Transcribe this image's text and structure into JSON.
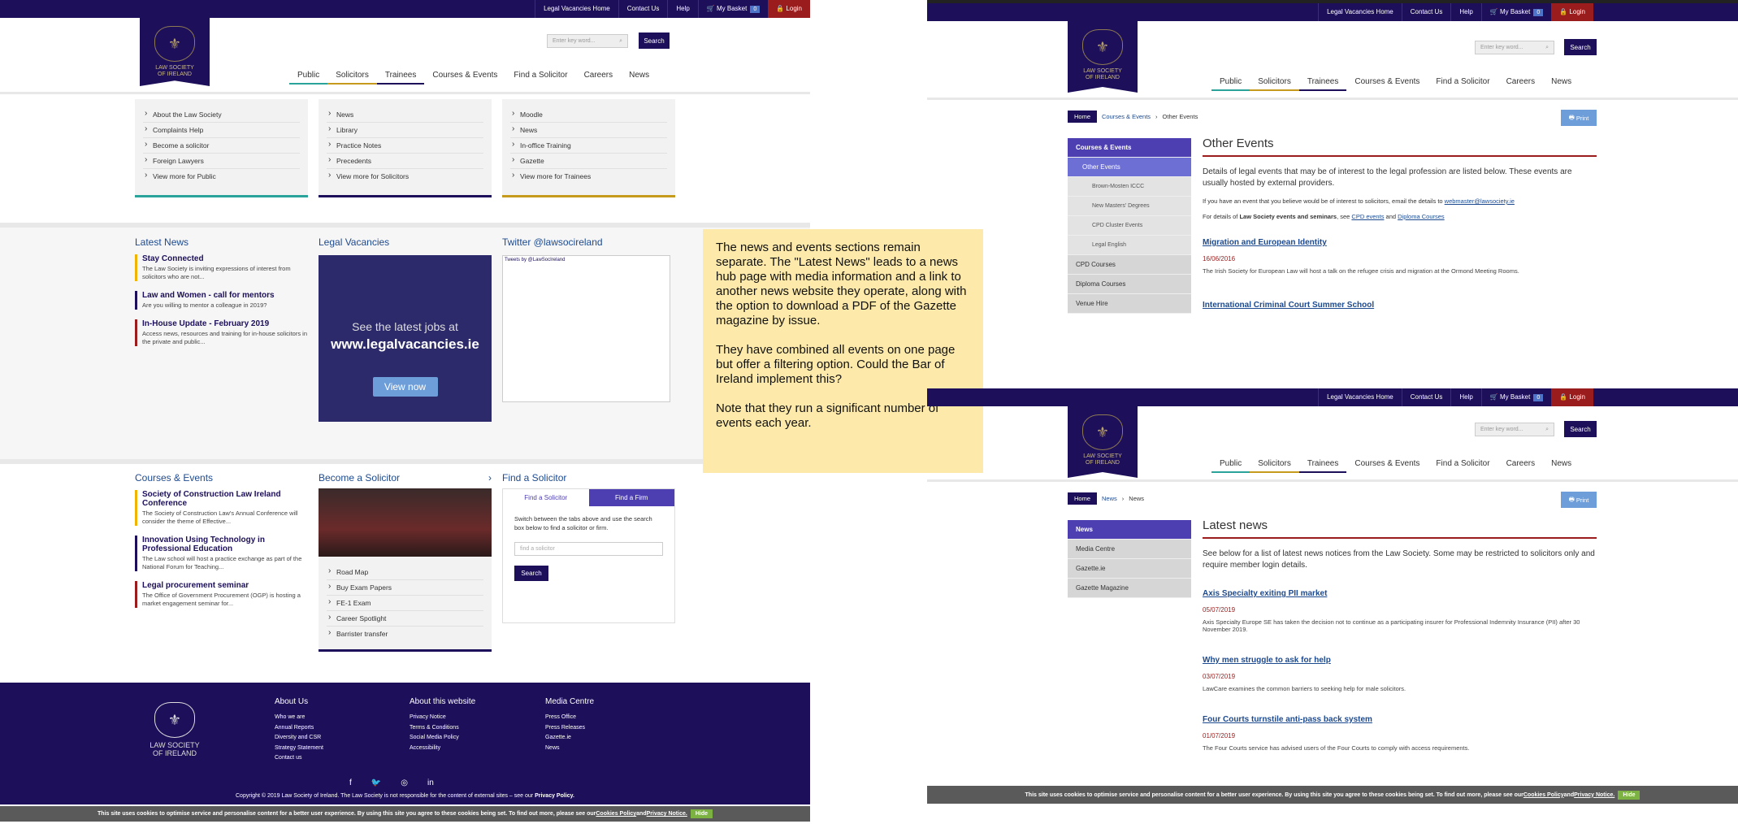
{
  "topnav": {
    "vacancies": "Legal Vacancies Home",
    "contact": "Contact Us",
    "help": "Help",
    "basket": "My Basket",
    "basket_count": "0",
    "login": "Login"
  },
  "logo": {
    "line1": "LAW SOCIETY",
    "line2": "OF IRELAND"
  },
  "search": {
    "placeholder": "Enter key word...",
    "button": "Search"
  },
  "mainnav": [
    "Public",
    "Solicitors",
    "Trainees",
    "Courses & Events",
    "Find a Solicitor",
    "Careers",
    "News"
  ],
  "mega": [
    [
      "About the Law Society",
      "Complaints Help",
      "Become a solicitor",
      "Foreign Lawyers",
      "View more for Public"
    ],
    [
      "News",
      "Library",
      "Practice Notes",
      "Precedents",
      "View more for Solicitors"
    ],
    [
      "Moodle",
      "News",
      "In-office Training",
      "Gazette",
      "View more for Trainees"
    ]
  ],
  "latest": {
    "title": "Latest News",
    "items": [
      {
        "t": "Stay Connected",
        "d": "The Law Society is inviting expressions of interest from solicitors who are not..."
      },
      {
        "t": "Law and Women - call for mentors",
        "d": "Are you willing to mentor a colleague in 2019?"
      },
      {
        "t": "In-House Update - February 2019",
        "d": "Access news, resources and training for in-house solicitors in the private and public..."
      }
    ]
  },
  "vacancies": {
    "title": "Legal Vacancies",
    "line1": "See the latest jobs at",
    "line2": "www.legalvacancies.ie",
    "button": "View now"
  },
  "twitter": {
    "title": "Twitter @lawsocireland",
    "tweets": "Tweets by @LawSocIreland"
  },
  "note": {
    "p1": "The news and events sections remain separate. The \"Latest News\" leads to a news hub page with media information and a link to another news website they operate, along with the option to download a PDF of the Gazette magazine by issue.",
    "p2": "They have combined all events on one page but offer a filtering option. Could the Bar of Ireland implement this?",
    "p3": "Note that they run a significant number of events each year."
  },
  "courses": {
    "title": "Courses & Events",
    "items": [
      {
        "t": "Society of Construction Law Ireland Conference",
        "d": "The Society of Construction Law's Annual Conference will consider the theme of Effective..."
      },
      {
        "t": "Innovation Using Technology in Professional Education",
        "d": "The Law school will host a practice exchange as part of the National Forum for Teaching..."
      },
      {
        "t": "Legal procurement seminar",
        "d": "The Office of Government Procurement (OGP) is hosting a market engagement seminar for..."
      }
    ]
  },
  "become": {
    "title": "Become a Solicitor",
    "items": [
      "Road Map",
      "Buy Exam Papers",
      "FE-1 Exam",
      "Career Spotlight",
      "Barrister transfer"
    ]
  },
  "find": {
    "title": "Find a Solicitor",
    "tab1": "Find a Solicitor",
    "tab2": "Find a Firm",
    "desc": "Switch between the tabs above and use the search box below to find a solicitor or firm.",
    "placeholder": "find a solicitor",
    "button": "Search"
  },
  "footer": {
    "about": {
      "title": "About Us",
      "items": [
        "Who we are",
        "Annual Reports",
        "Diversity and CSR",
        "Strategy Statement",
        "Contact us"
      ]
    },
    "website": {
      "title": "About this website",
      "items": [
        "Privacy Notice",
        "Terms & Conditions",
        "Social Media Policy",
        "Accessibility"
      ]
    },
    "media": {
      "title": "Media Centre",
      "items": [
        "Press Office",
        "Press Releases",
        "Gazette.ie",
        "News"
      ]
    },
    "copyright": "Copyright © 2019 Law Society of Ireland. The Law Society is not responsible for the content of external sites – see our ",
    "privacy": "Privacy Policy."
  },
  "cookie": {
    "text": "This site uses cookies to optimise service and personalise content for a better user experience. By using this site you agree to these cookies being set. To find out more, please see our ",
    "policy": "Cookies Policy",
    "and": " and ",
    "privacy": "Privacy Notice.",
    "hide": "Hide"
  },
  "events": {
    "crumb": [
      "Home",
      "Courses & Events",
      "Other Events"
    ],
    "print": "Print",
    "side": [
      "Courses & Events",
      "Other Events",
      "Brown-Mosten ICCC",
      "New Masters' Degrees",
      "CPD Cluster Events",
      "Legal English",
      "CPD Courses",
      "Diploma Courses",
      "Venue Hire"
    ],
    "title": "Other Events",
    "intro": "Details of legal events that may be of interest to the legal profession are listed below. These events are usually hosted by external providers.",
    "email_pre": "If you have an event that you believe would be of interest to solicitors, email the details to ",
    "email": "webmaster@lawsociety.ie",
    "details_pre": "For details of ",
    "details_bold": "Law Society events and seminars",
    "details_mid": ", see ",
    "cpd": "CPD events",
    "and": " and ",
    "diploma": "Diploma Courses",
    "e1": {
      "t": "Migration and European Identity",
      "d": "16/06/2016",
      "x": "The Irish Society for European Law will host a talk on the refugee crisis and migration at the Ormond Meeting Rooms."
    },
    "e2": {
      "t": "International Criminal Court Summer School"
    }
  },
  "newspage": {
    "crumb": [
      "Home",
      "News",
      "News"
    ],
    "print": "Print",
    "side": [
      "News",
      "Media Centre",
      "Gazette.ie",
      "Gazette Magazine"
    ],
    "title": "Latest news",
    "intro": "See below for a list of latest news notices from the Law Society. Some may be restricted to solicitors only and require member login details.",
    "items": [
      {
        "t": "Axis Specialty exiting PII market",
        "d": "05/07/2019",
        "x": "Axis Specialty Europe SE has taken the decision not to continue as a participating insurer for Professional Indemnity Insurance (PII) after 30 November 2019."
      },
      {
        "t": "Why men struggle to ask for help",
        "d": "03/07/2019",
        "x": "LawCare examines the common barriers to seeking help for male solicitors."
      },
      {
        "t": "Four Courts turnstile anti-pass back system",
        "d": "01/07/2019",
        "x": "The Four Courts service has advised users of the Four Courts to comply with access requirements."
      }
    ]
  },
  "colors": {
    "navy": "#1d0f5a",
    "login_red": "#9b1c1c",
    "note": "#fde9a9",
    "public": "#2aa39a",
    "solicitors": "#c59a1d",
    "trainees": "#1d0f5a"
  }
}
